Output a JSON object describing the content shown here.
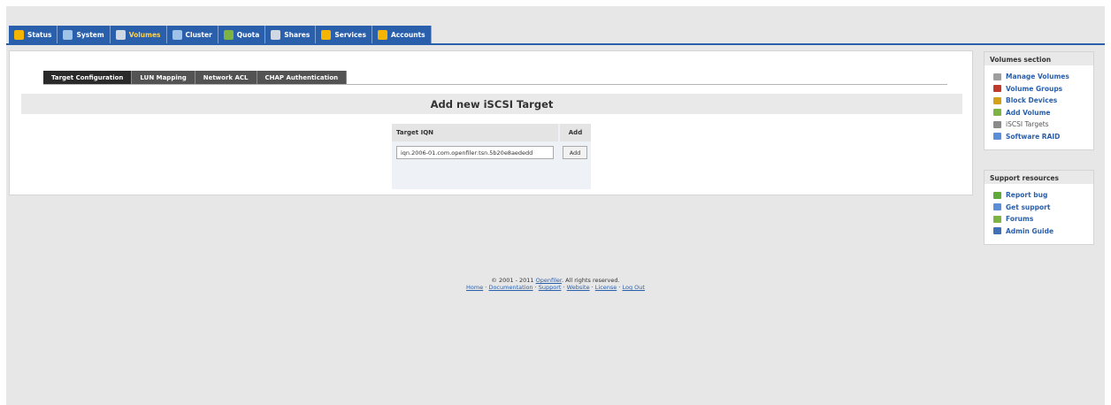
{
  "top_nav": {
    "tabs": [
      {
        "label": "Status",
        "icon": "status-icon",
        "color": "#f4b400"
      },
      {
        "label": "System",
        "icon": "system-icon",
        "color": "#9fc2e8"
      },
      {
        "label": "Volumes",
        "icon": "volumes-icon",
        "color": "#cfd8e3"
      },
      {
        "label": "Cluster",
        "icon": "cluster-icon",
        "color": "#9fc2e8"
      },
      {
        "label": "Quota",
        "icon": "quota-icon",
        "color": "#7cb342"
      },
      {
        "label": "Shares",
        "icon": "shares-icon",
        "color": "#cfd8e3"
      },
      {
        "label": "Services",
        "icon": "services-icon",
        "color": "#f4b400"
      },
      {
        "label": "Accounts",
        "icon": "accounts-icon",
        "color": "#f4b400"
      }
    ],
    "active": "Volumes",
    "active_color": "#ffd24d",
    "bar_color": "#2a5fab"
  },
  "sub_tabs": [
    {
      "label": "Target Configuration"
    },
    {
      "label": "LUN Mapping"
    },
    {
      "label": "Network ACL"
    },
    {
      "label": "CHAP Authentication"
    }
  ],
  "section_title": "Add new iSCSI Target",
  "table": {
    "col_target": "Target IQN",
    "col_add": "Add",
    "iqn_value": "iqn.2006-01.com.openfiler:tsn.5b20e8aededd",
    "add_label": "Add"
  },
  "volumes_section": {
    "title": "Volumes section",
    "items": [
      {
        "label": "Manage Volumes",
        "icon": "manage-volumes-icon"
      },
      {
        "label": "Volume Groups",
        "icon": "volume-groups-icon"
      },
      {
        "label": "Block Devices",
        "icon": "block-devices-icon"
      },
      {
        "label": "Add Volume",
        "icon": "add-volume-icon"
      },
      {
        "label": "iSCSI Targets",
        "icon": "iscsi-targets-icon"
      },
      {
        "label": "Software RAID",
        "icon": "software-raid-icon"
      }
    ]
  },
  "support_resources": {
    "title": "Support resources",
    "items": [
      {
        "label": "Report bug",
        "icon": "report-bug-icon"
      },
      {
        "label": "Get support",
        "icon": "get-support-icon"
      },
      {
        "label": "Forums",
        "icon": "forums-icon"
      },
      {
        "label": "Admin Guide",
        "icon": "admin-guide-icon"
      }
    ]
  },
  "footer": {
    "copyright_prefix": "© 2001 - 2011",
    "brand": "Openfiler",
    "copyright_suffix": ". All rights reserved.",
    "links": [
      "Home",
      "Documentation",
      "Support",
      "Website",
      "License",
      "Log Out"
    ],
    "separator": " · "
  }
}
